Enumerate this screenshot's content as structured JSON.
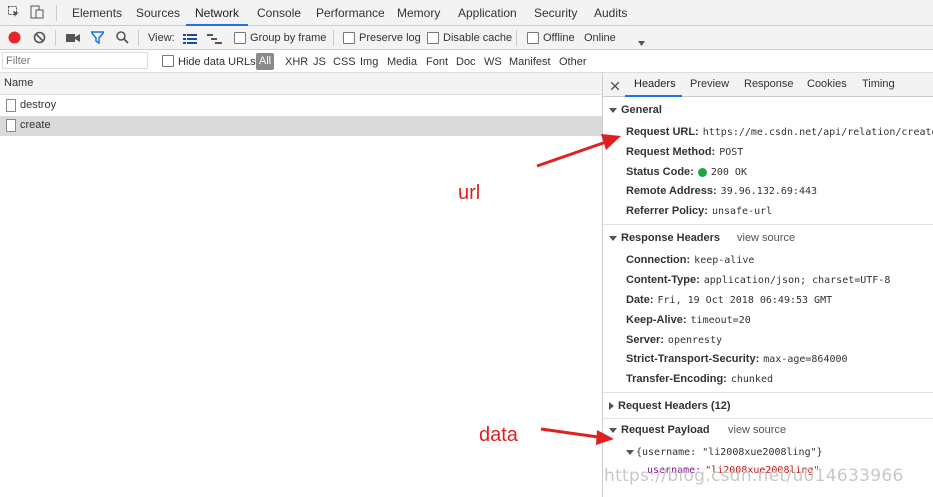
{
  "devtools_tabs": [
    "Elements",
    "Sources",
    "Network",
    "Console",
    "Performance",
    "Memory",
    "Application",
    "Security",
    "Audits"
  ],
  "toolbar": {
    "view_label": "View:",
    "group_by_frame": "Group by frame",
    "preserve_log": "Preserve log",
    "disable_cache": "Disable cache",
    "offline": "Offline",
    "throttle": "Online"
  },
  "filterbar": {
    "filter_placeholder": "Filter",
    "hide_data_urls": "Hide data URLs",
    "all": "All",
    "types": [
      "XHR",
      "JS",
      "CSS",
      "Img",
      "Media",
      "Font",
      "Doc",
      "WS",
      "Manifest",
      "Other"
    ]
  },
  "request_list": {
    "header": "Name",
    "items": [
      "destroy",
      "create"
    ]
  },
  "detail_tabs": [
    "Headers",
    "Preview",
    "Response",
    "Cookies",
    "Timing"
  ],
  "general": {
    "title": "General",
    "request_url_label": "Request URL:",
    "request_url": "https://me.csdn.net/api/relation/create",
    "request_method_label": "Request Method:",
    "request_method": "POST",
    "status_code_label": "Status Code:",
    "status_code": "200 OK",
    "remote_address_label": "Remote Address:",
    "remote_address": "39.96.132.69:443",
    "referrer_policy_label": "Referrer Policy:",
    "referrer_policy": "unsafe-url"
  },
  "response_headers": {
    "title": "Response Headers",
    "view_source": "view source",
    "items": [
      {
        "k": "Connection:",
        "v": "keep-alive"
      },
      {
        "k": "Content-Type:",
        "v": "application/json; charset=UTF-8"
      },
      {
        "k": "Date:",
        "v": "Fri, 19 Oct 2018 06:49:53 GMT"
      },
      {
        "k": "Keep-Alive:",
        "v": "timeout=20"
      },
      {
        "k": "Server:",
        "v": "openresty"
      },
      {
        "k": "Strict-Transport-Security:",
        "v": "max-age=864000"
      },
      {
        "k": "Transfer-Encoding:",
        "v": "chunked"
      }
    ]
  },
  "request_headers": {
    "title": "Request Headers (12)"
  },
  "request_payload": {
    "title": "Request Payload",
    "view_source": "view source",
    "summary": "{username: \"li2008xue2008ling\"}",
    "key": "username:",
    "value": "\"li2008xue2008ling\""
  },
  "annotations": {
    "url": "url",
    "data": "data"
  },
  "watermark": "https://blog.csdn.net/u014633966",
  "colors": {
    "accent": "#1a73e8",
    "record": "#e8262a",
    "arrow": "#e02020",
    "status_ok": "#1ea446"
  }
}
